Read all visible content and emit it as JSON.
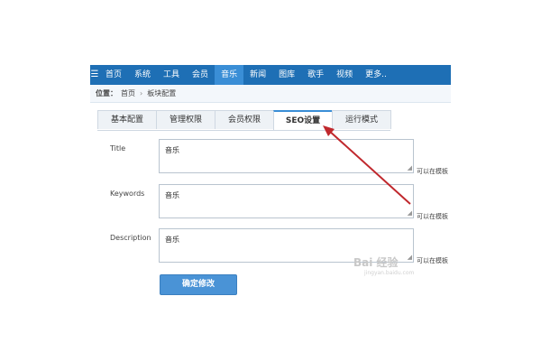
{
  "nav": {
    "items": [
      {
        "label": "首页"
      },
      {
        "label": "系统"
      },
      {
        "label": "工具"
      },
      {
        "label": "会员"
      },
      {
        "label": "音乐"
      },
      {
        "label": "新闻"
      },
      {
        "label": "图库"
      },
      {
        "label": "歌手"
      },
      {
        "label": "视频"
      },
      {
        "label": "更多.."
      }
    ],
    "active": "音乐"
  },
  "breadcrumb": {
    "label": "位置：",
    "items": [
      "首页",
      "板块配置"
    ]
  },
  "tabs": [
    {
      "label": "基本配置"
    },
    {
      "label": "管理权限"
    },
    {
      "label": "会员权限"
    },
    {
      "label": "SEO设置"
    },
    {
      "label": "运行模式"
    }
  ],
  "active_tab": "SEO设置",
  "form": {
    "title": {
      "label": "Title",
      "value": "音乐",
      "hint": "可以在模板"
    },
    "keywords": {
      "label": "Keywords",
      "value": "音乐",
      "hint": "可以在模板"
    },
    "description": {
      "label": "Description",
      "value": "音乐",
      "hint": "可以在模板"
    }
  },
  "submit_label": "确定修改",
  "watermark": {
    "text": "Bai 经验",
    "sub": "jingyan.baidu.com"
  },
  "colors": {
    "nav_bg": "#1e6fb5",
    "nav_active": "#3a8ed6",
    "button": "#4a93d6",
    "arrow": "#c0282d"
  }
}
